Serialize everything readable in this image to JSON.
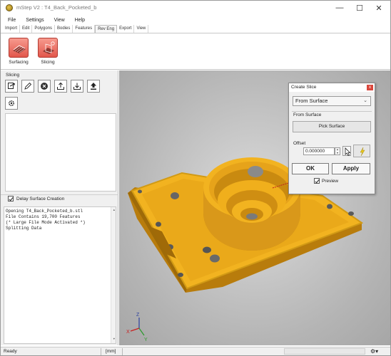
{
  "window": {
    "title": "mStep V2 : T4_Back_Pocketed_b",
    "minimize_glyph": "—",
    "maximize_glyph": "☐",
    "close_glyph": "✕"
  },
  "menu": [
    "File",
    "Settings",
    "View",
    "Help"
  ],
  "tabs": [
    {
      "label": "Import",
      "active": false
    },
    {
      "label": "Edit",
      "active": false
    },
    {
      "label": "Polygons",
      "active": false
    },
    {
      "label": "Bodies",
      "active": false
    },
    {
      "label": "Features",
      "active": false
    },
    {
      "label": "Rev Eng",
      "active": true
    },
    {
      "label": "Export",
      "active": false
    },
    {
      "label": "View",
      "active": false
    }
  ],
  "ribbon": {
    "surfacing_label": "Surfacing",
    "slicing_label": "Slicing"
  },
  "left_panel": {
    "title": "Slicing",
    "tools": [
      "slice-add-icon",
      "pencil-icon",
      "delete-icon",
      "export-icon",
      "import-icon",
      "upload-icon",
      "gear-icon"
    ],
    "delay_label": "Delay Surface Creation",
    "delay_checked": true
  },
  "log": [
    "Opening T4_Back_Pocketed_b.stl",
    "File Contains 19,700 Features",
    "(* Large File Mode Activated *)",
    "Splitting Data"
  ],
  "dialog": {
    "title": "Create Slice",
    "close_glyph": "x",
    "mode_value": "From Surface",
    "section_label": "From Surface",
    "pick_button": "Pick Surface",
    "offset_label": "Offset",
    "offset_value": "0.000000",
    "ok_label": "OK",
    "apply_label": "Apply",
    "preview_label": "Preview",
    "preview_checked": true
  },
  "status": {
    "left": "Ready",
    "units": "[mm]"
  },
  "colors": {
    "part": "#f2b320",
    "part_shadow": "#c98a10",
    "ribbon_icon": "#e2574c",
    "background": "#b8b8b8"
  }
}
